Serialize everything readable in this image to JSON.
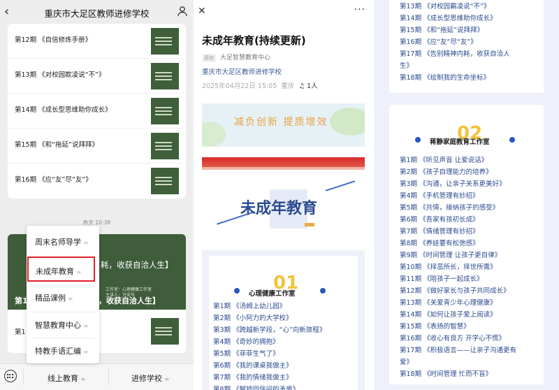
{
  "chat": {
    "title": "重庆市大足区教师进修学校",
    "rows": [
      "第12期 《自信修炼手册》",
      "第13期 《对校园欺凌说“不”》",
      "第14期 《成长型思维助你成长》",
      "第15期 《和“拖延”说拜拜》",
      "第16期 《应“友”尽“友”》"
    ],
    "timestamp": "昨天 10:38",
    "featured": {
      "title_part": "耗，收获自洽人生】",
      "subtitle1": "工作室：心理健康工作室",
      "subtitle2": "主讲人：万安华",
      "bottom_prefix": "第1",
      "bottom_title": "，收获自洽人生】"
    },
    "last_row": "第1",
    "menu": [
      "周末名师导学",
      "未成年教育",
      "精品课例",
      "智慧教育中心",
      "特教手语汇编"
    ],
    "bottom_tabs": [
      "线上教育",
      "进修学校"
    ],
    "menu_marker": "≡"
  },
  "article": {
    "title": "未成年教育(持续更新)",
    "tag": "原创",
    "source": "大足智慧教育中心",
    "org": "重庆市大足区教师进修学校",
    "date": "2025年04月22日 15:05",
    "location": "重庆",
    "listeners": "1人",
    "banner_text": "减负创新  提质增效",
    "hero_text": "未成年教育",
    "section1": {
      "num": "01",
      "title": "心理健康工作室"
    },
    "items1": [
      "第1期 《汤姆上幼儿园》",
      "第2期 《小阿力的大学校》",
      "第3期 《跨越新学段，“心”向新旅程》",
      "第4期 《奇妙的拥抱》",
      "第5期 《菲菲生气了》",
      "第6期 《我的课桌我做主》",
      "第7期 《我的情绪我做主》",
      "第8期 《解锁同伴间的矛盾》"
    ]
  },
  "continuation": {
    "items_top": [
      "第13期 《对校园霸凌说“不”》",
      "第14期 《成长型思维助你成长》",
      "第15期 《和“拖延”说拜拜》",
      "第16期 《应“友”尽“友”》",
      "第17期 《告别精神内耗，收获自洽人",
      "生》",
      "第18期 《绘制我的生命坐标》"
    ],
    "section2": {
      "num": "02",
      "title": "蒋静家庭教育工作室"
    },
    "items2": [
      "第1期 《听见声音 让爱说话》",
      "第2期 《孩子自理能力的培养》",
      "第3期 《沟通，让亲子关系更美好》",
      "第4期 《手机管理有妙招》",
      "第5期 《共情，接纳孩子的感受》",
      "第6期 《吾家有孩初长成》",
      "第7期 《情绪管理有妙招》",
      "第8期 《养娃要有松弛感》",
      "第9期 《时间管理 让孩子更自律》",
      "第10期 《择茁所长，择世所需》",
      "第11期 《陪孩子一起成长》",
      "第12期 《做好家长与孩子共同成长》",
      "第13期 《关爱青少年心理健康》",
      "第14期 《如何让孩子爱上阅读》",
      "第15期 《表扬的智慧》",
      "第16期 《收心有良方 开学心不慌》",
      "第17期 《积极语言——让亲子沟通更有",
      "爱》",
      "第18期 《时间管理 忙而不盲》"
    ]
  },
  "colors": {
    "accent_red": "#e0212b",
    "link_blue": "#2b4a8f",
    "green_card": "#3f5d3b"
  }
}
